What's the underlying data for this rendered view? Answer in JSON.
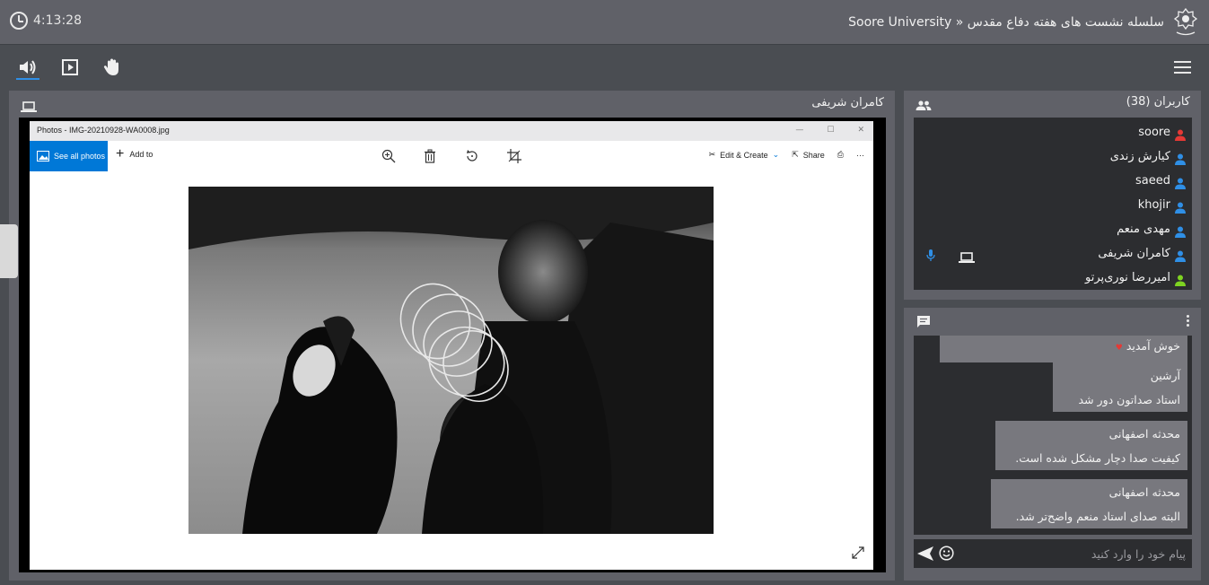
{
  "header": {
    "timer": "4:13:28",
    "title": "Soore University » سلسله نشست های هفته دفاع مقدس"
  },
  "toolbar": {
    "icons": [
      "speaker-icon",
      "play-screen-icon",
      "raise-hand-icon",
      "menu-icon"
    ]
  },
  "presenter": {
    "name": "کامران شریفی",
    "photos_app": {
      "window_title": "Photos - IMG-20210928-WA0008.jpg",
      "see_all": "See all photos",
      "add_to": "Add to",
      "edit_create": "Edit & Create",
      "share": "Share",
      "more": "···"
    }
  },
  "users": {
    "title": "کاربران (38)",
    "list": [
      {
        "name": "soore",
        "icon_color": "#e53935"
      },
      {
        "name": "کیارش زندی",
        "icon_color": "#2f8fe6"
      },
      {
        "name": "saeed",
        "icon_color": "#2f8fe6"
      },
      {
        "name": "khojir",
        "icon_color": "#2f8fe6"
      },
      {
        "name": "مهدی منعم",
        "icon_color": "#2f8fe6"
      },
      {
        "name": "کامران شریفی",
        "icon_color": "#2f8fe6",
        "mic": true,
        "screen": true
      },
      {
        "name": "امیررضا نوری‌پرتو",
        "icon_color": "#7ed321"
      }
    ]
  },
  "chat": {
    "messages": [
      {
        "sender": "",
        "text": "خوش آمدید"
      },
      {
        "sender": "آرشین",
        "text": "استاد صداتون دور شد"
      },
      {
        "sender": "محدثه اصفهانی",
        "text": "کیفیت صدا دچار مشکل شده است."
      },
      {
        "sender": "محدثه اصفهانی",
        "text": "البته صدای استاد منعم واضح‌تر شد."
      }
    ],
    "input_placeholder": "پیام خود را وارد کنید"
  },
  "colors": {
    "accent": "#2f8fe6",
    "panel": "#606168",
    "dark_panel": "#2c2d30",
    "background": "#4a4d52"
  }
}
